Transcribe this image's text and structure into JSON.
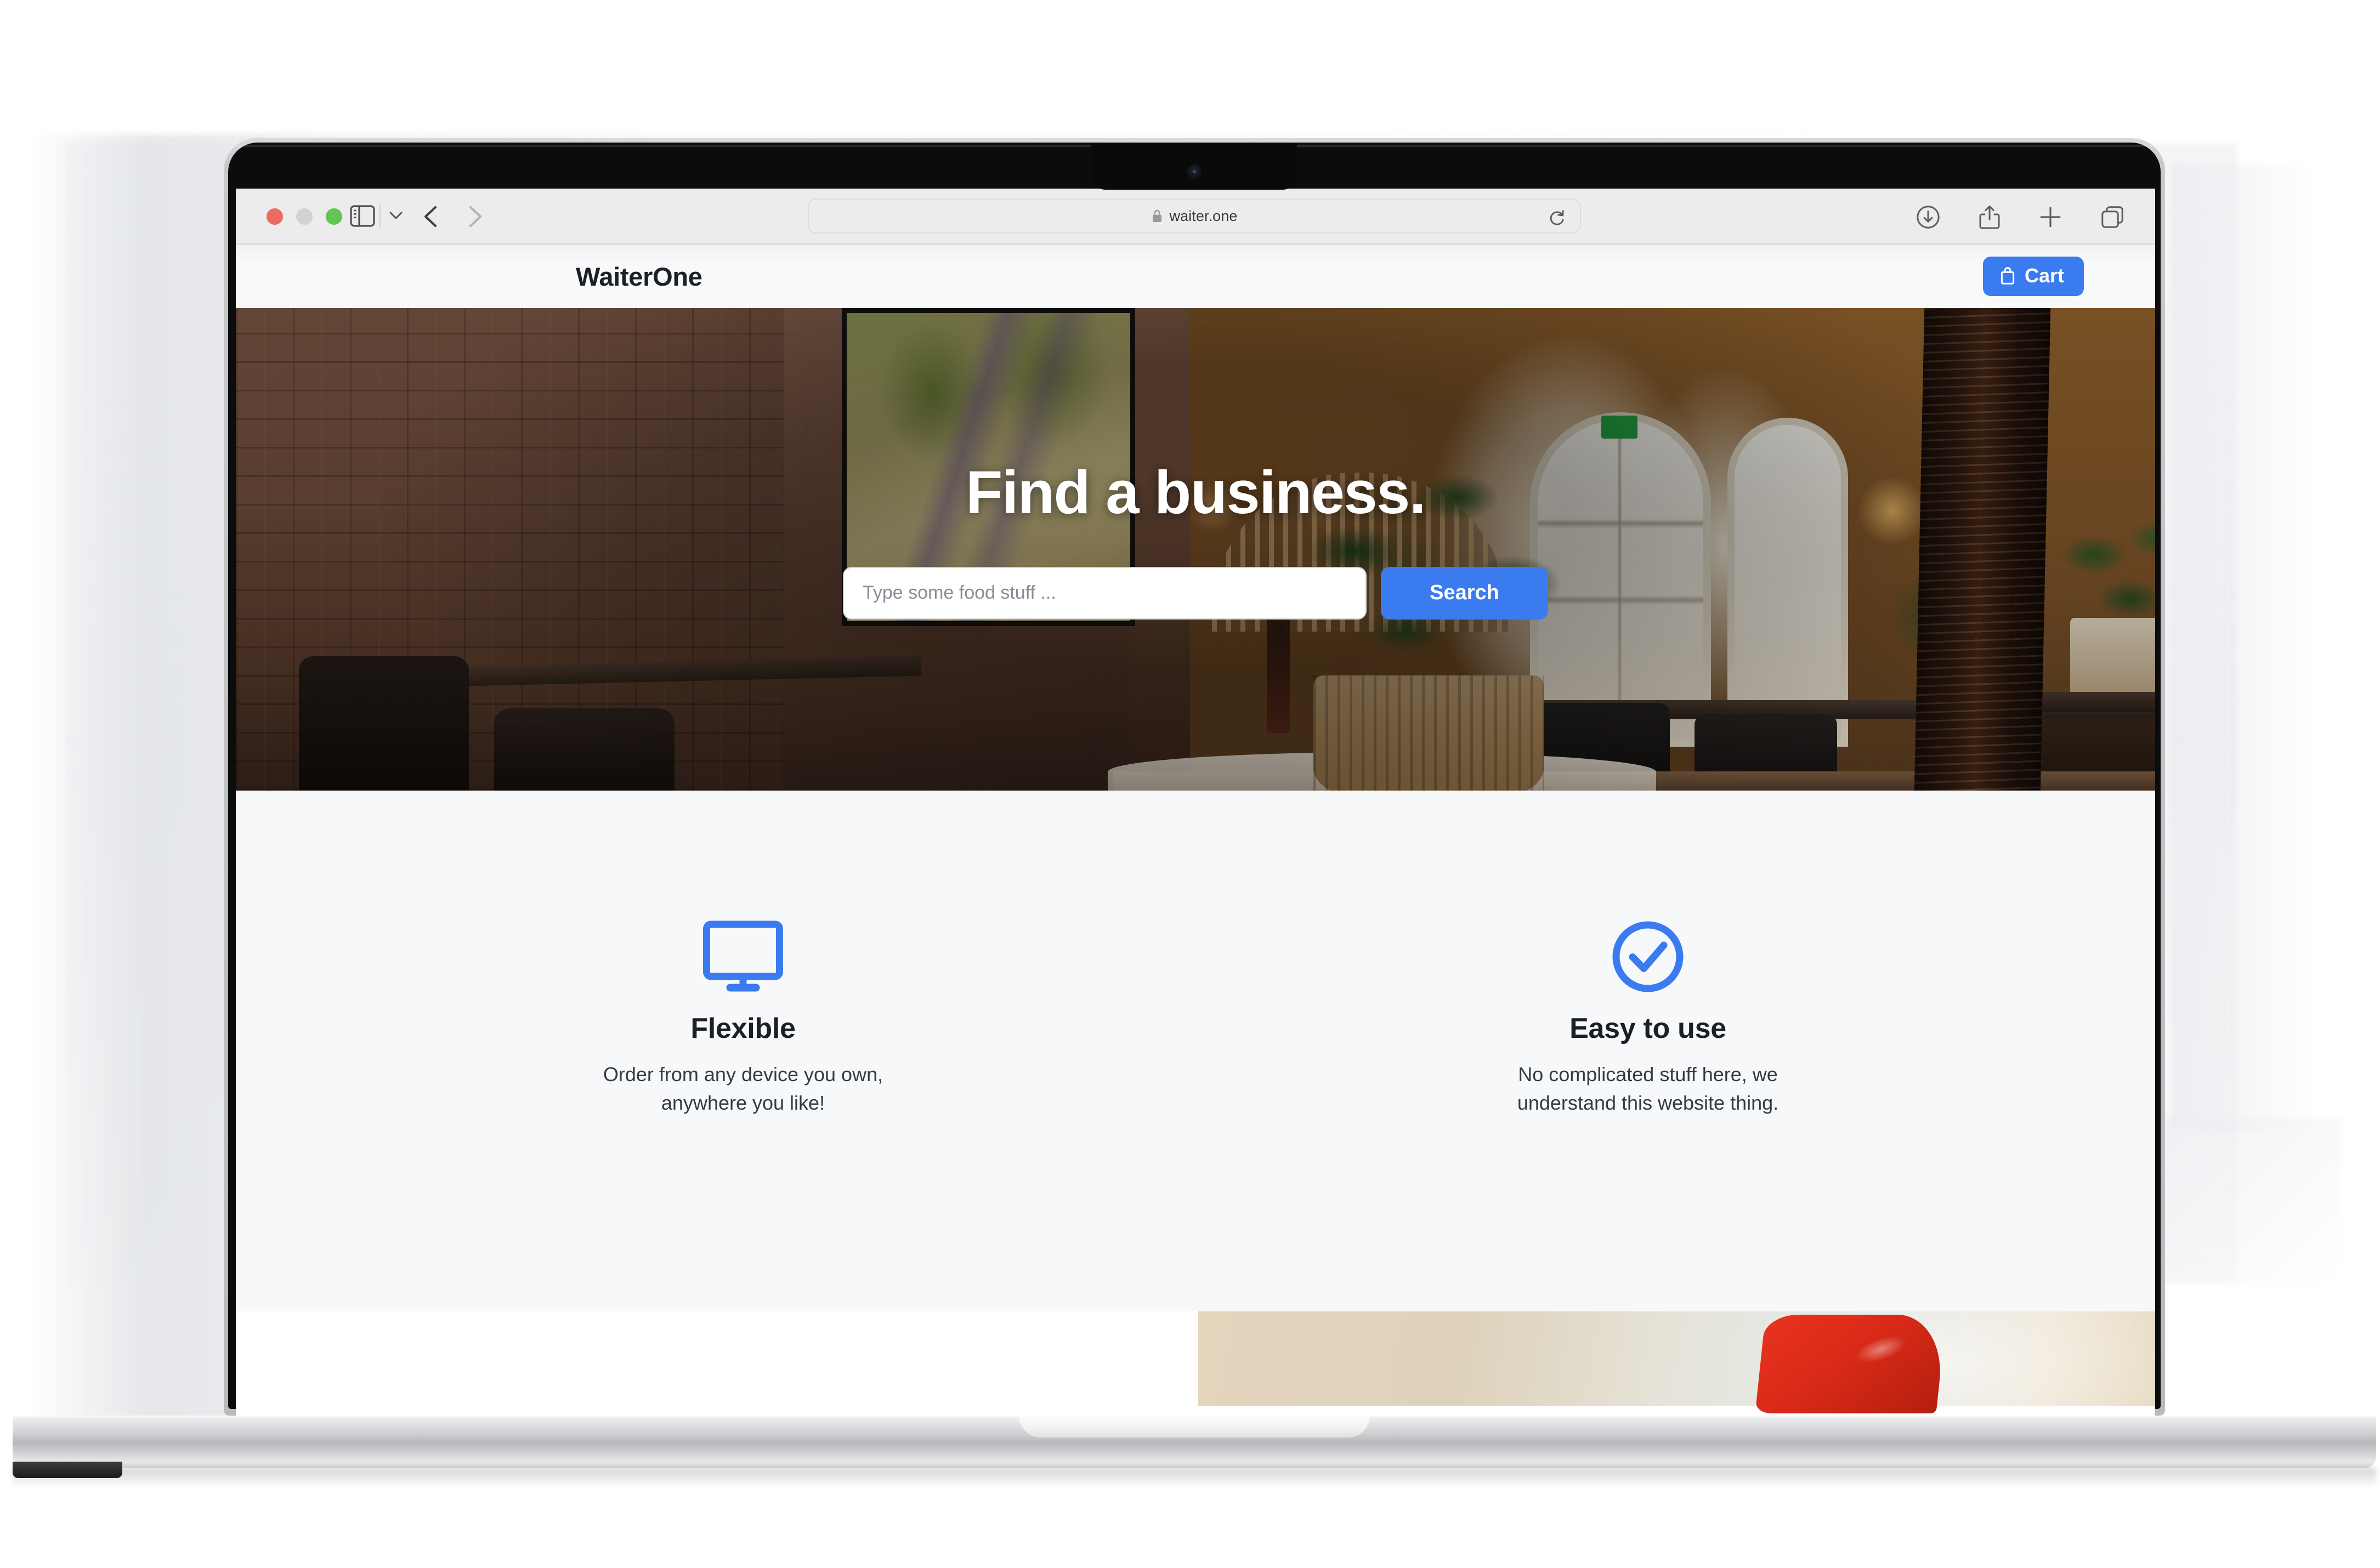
{
  "browser": {
    "name": "safari",
    "url": "waiter.one",
    "lock_icon": "lock-icon",
    "traffic_lights": [
      "close-red",
      "minimize-yellow",
      "maximize-green"
    ],
    "toolbar_icons": [
      "sidebar-toggle-icon",
      "chevron-down-icon",
      "back-arrow-icon",
      "forward-arrow-icon",
      "reload-icon",
      "downloads-icon",
      "share-icon",
      "new-tab-icon",
      "tab-overview-icon"
    ]
  },
  "device": {
    "type": "macbook",
    "notch": true,
    "camera": "camera-icon"
  },
  "site": {
    "navbar": {
      "brand": "WaiterOne",
      "cart_label": "Cart",
      "cart_icon": "shopping-bag-icon"
    },
    "hero": {
      "title": "Find a business.",
      "search_placeholder": "Type some food stuff ...",
      "search_value": "",
      "search_button": "Search",
      "background": "restaurant-interior-photo"
    },
    "features": [
      {
        "icon": "desktop-monitor-icon",
        "title": "Flexible",
        "description": "Order from any device you own, anywhere you like!"
      },
      {
        "icon": "check-circle-icon",
        "title": "Easy to use",
        "description": "No complicated stuff here, we understand this website thing."
      }
    ],
    "bottom_section": {
      "image": "red-object-photo"
    }
  },
  "colors": {
    "accent_blue": "#3b7bf0",
    "feature_bg": "#f7f8fa",
    "navbar_bg": "#f8f9fb",
    "text_dark": "#1c1f24",
    "text_body": "#343a40",
    "chrome_bg": "#ececec"
  }
}
